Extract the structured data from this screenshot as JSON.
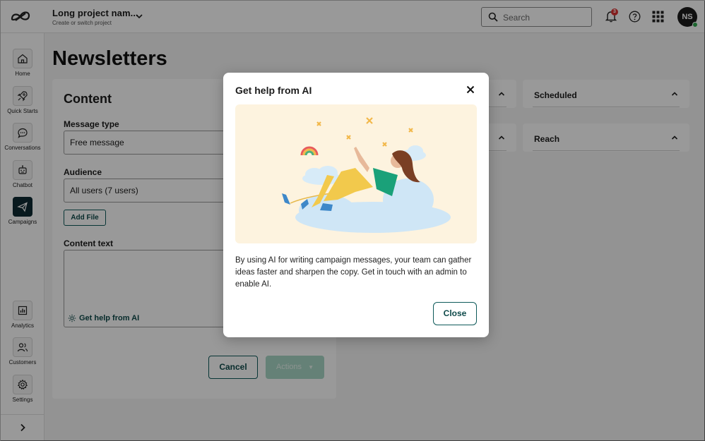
{
  "header": {
    "project_name": "Long project  nam...",
    "project_sub": "Create or switch project",
    "search_placeholder": "Search",
    "notification_count": "3",
    "avatar_initials": "NS"
  },
  "sidebar": {
    "items": [
      {
        "label": "Home",
        "icon": "home-icon"
      },
      {
        "label": "Quick Starts",
        "icon": "rocket-icon"
      },
      {
        "label": "Conversations",
        "icon": "chat-icon"
      },
      {
        "label": "Chatbot",
        "icon": "bot-icon"
      },
      {
        "label": "Campaigns",
        "icon": "send-icon",
        "active": true
      },
      {
        "label": "Analytics",
        "icon": "bar-chart-icon"
      },
      {
        "label": "Customers",
        "icon": "users-icon"
      },
      {
        "label": "Settings",
        "icon": "gear-icon"
      }
    ]
  },
  "main": {
    "page_title": "Newsletters",
    "content_card": {
      "title": "Content",
      "message_type_label": "Message type",
      "message_type_value": "Free message",
      "audience_label": "Audience",
      "audience_value": "All users (7 users)",
      "add_file_label": "Add File",
      "content_text_label": "Content text",
      "ai_link_label": "Get help from AI",
      "cancel_label": "Cancel",
      "actions_label": "Actions"
    },
    "panels": {
      "scheduled": "Scheduled",
      "reach": "Reach"
    }
  },
  "modal": {
    "title": "Get help from AI",
    "body": "By using AI for writing campaign messages, your team can gather ideas faster and sharpen the copy.  Get in touch with an admin to enable AI.",
    "close_label": "Close"
  },
  "colors": {
    "accent": "#0e4a4a",
    "active_nav": "#0e2a33",
    "illustration_bg": "#fdf3df",
    "actions_disabled": "#a8d8c6"
  }
}
